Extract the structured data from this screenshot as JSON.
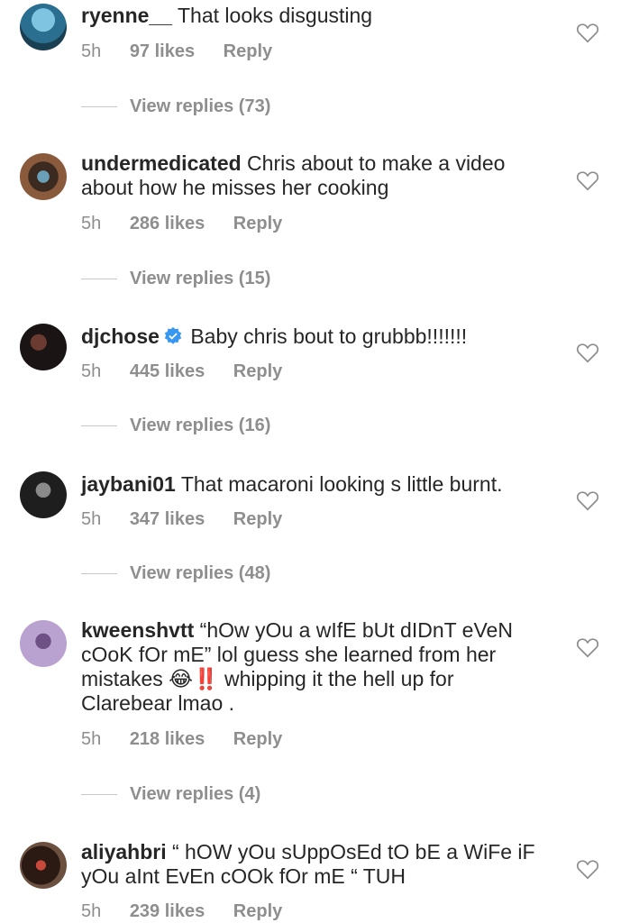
{
  "comments": [
    {
      "username": "ryenne__",
      "text": "That looks disgusting",
      "time": "5h",
      "likes": "97 likes",
      "reply": "Reply",
      "view_replies": "View replies (73)",
      "avatar_colors": [
        "#2a6f8f",
        "#7fc4e0"
      ]
    },
    {
      "username": "undermedicated",
      "text": "Chris about to make a video about how he misses her cooking",
      "time": "5h",
      "likes": "286 likes",
      "reply": "Reply",
      "view_replies": "View replies (15)",
      "avatar_colors": [
        "#3b2a20",
        "#6a9fb8"
      ]
    },
    {
      "username": "djchose",
      "text": "Baby chris bout to grubbb!!!!!!!",
      "time": "5h",
      "likes": "445 likes",
      "reply": "Reply",
      "view_replies": "View replies (16)",
      "avatar_colors": [
        "#1a1414",
        "#6b3a30"
      ]
    },
    {
      "username": "jaybani01",
      "text": "That macaroni looking s little burnt.",
      "time": "5h",
      "likes": "347 likes",
      "reply": "Reply",
      "view_replies": "View replies (48)",
      "avatar_colors": [
        "#1e1e1e",
        "#8a8a8a"
      ]
    },
    {
      "username": "kweenshvtt",
      "text": "“hOw yOu a wIfE bUt dIDnT eVeN cOoK fOr mE” lol guess she learned from her mistakes 😂‼️ whipping it the hell up for Clarebear lmao .",
      "time": "5h",
      "likes": "218 likes",
      "reply": "Reply",
      "view_replies": "View replies (4)",
      "avatar_colors": [
        "#b9a2cf",
        "#6e4f86"
      ]
    },
    {
      "username": "aliyahbri",
      "text": "“ hOW yOu sUppOsEd tO bE a WiFe iF yOu aInt EvEn cOOk fOr mE “ TUH",
      "time": "5h",
      "likes": "239 likes",
      "reply": "Reply",
      "view_replies": "",
      "avatar_colors": [
        "#2b1a14",
        "#c94a3a"
      ]
    }
  ],
  "colors": {
    "text": "#262626",
    "meta": "#8e8e8e",
    "verified": "#3897f0"
  },
  "icons": {
    "like": "heart-outline-icon",
    "verified": "verified-badge-icon"
  }
}
